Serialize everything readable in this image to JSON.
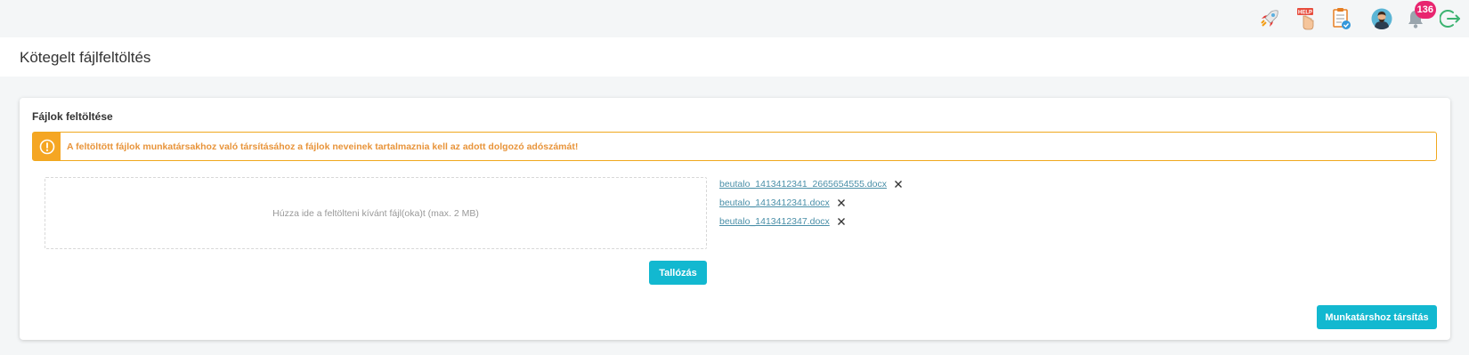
{
  "topbar": {
    "icons": [
      "rocket-icon",
      "help-icon",
      "checklist-icon",
      "avatar",
      "bell-icon",
      "logout-icon"
    ],
    "help_label": "HELP",
    "notification_count": "136"
  },
  "header": {
    "title": "Kötegelt fájlfeltöltés"
  },
  "card": {
    "title": "Fájlok feltöltése",
    "alert_text": "A feltöltött fájlok munkatársakhoz való társításához a fájlok neveinek tartalmaznia kell az adott dolgozó adószámát!",
    "dropzone_text": "Húzza ide a feltölteni kívánt fájl(oka)t (max. 2 MB)",
    "files": [
      {
        "name": "beutalo_1413412341_2665654555.docx"
      },
      {
        "name": "beutalo_1413412341.docx"
      },
      {
        "name": "beutalo_1413412347.docx"
      }
    ],
    "browse_label": "Tallózás",
    "assign_label": "Munkatárshoz társítás"
  },
  "colors": {
    "accent": "#12b8d0",
    "warning": "#f5a623",
    "badge": "#e8256f",
    "link": "#4a8fa8"
  }
}
